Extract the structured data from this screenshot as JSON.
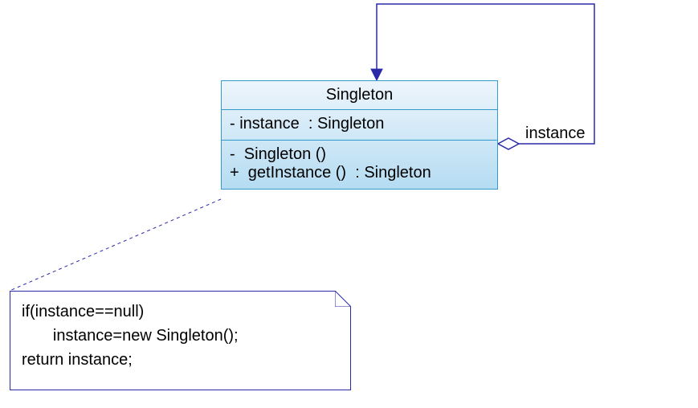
{
  "uml_class": {
    "name": "Singleton",
    "attributes": [
      {
        "vis": "-",
        "text": "instance  : Singleton"
      }
    ],
    "operations": [
      {
        "vis": "-",
        "text": " Singleton ()"
      },
      {
        "vis": "+",
        "text": " getInstance ()  : Singleton"
      }
    ]
  },
  "association": {
    "role_label": "instance"
  },
  "note": {
    "lines": [
      "if(instance==null)",
      "       instance=new Singleton();",
      "return instance;"
    ]
  },
  "colors": {
    "class_border": "#339acc",
    "class_fill_top": "#edf5fc",
    "class_fill_bottom": "#b5dcf2",
    "note_border": "#2a2aa9",
    "assoc_line": "#2a2aa9"
  }
}
